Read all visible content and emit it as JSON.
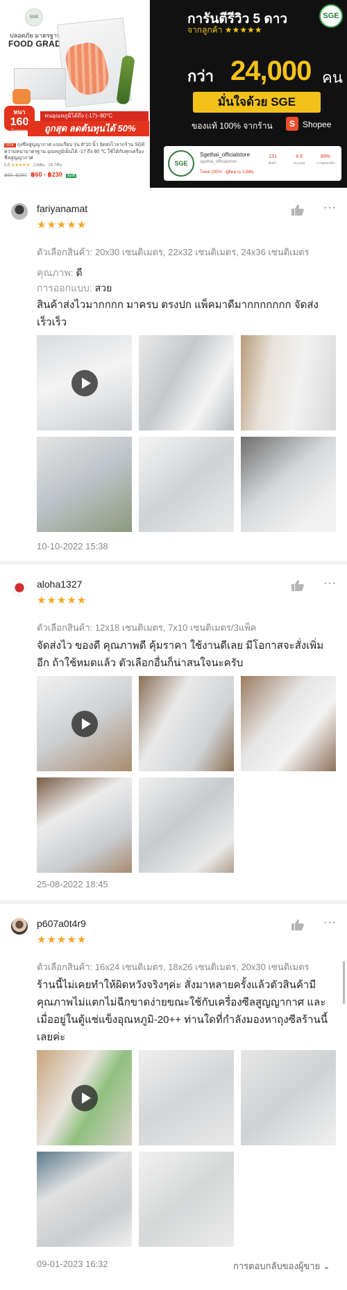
{
  "banner_left": {
    "logo_text": "SGE",
    "tagline": "ปลอดภัย มาตรฐาน",
    "food_grade": "FOOD GRADE",
    "thickness_badge": {
      "label": "หนา",
      "value": "160",
      "unit": "ไมครอน"
    },
    "temperature_note": "ทนอุณหภูมิได้ถึง (-17)–80°C",
    "sale_text": "ถูกสุด ลดต้นทุนได้ 50%",
    "seller_tag": "SGE",
    "product_title": "ถุงซีลสูญญากาศ แบบเรียบ รุ่น 8*10 นิ้ว จัดส่งไวจากร้าน SGE ความหนามาตรฐาน อุณหภูมิเย็นได้ -17 ถึง 80 ℃ ใช้ได้กับทุกเครื่องซีลสูญญากาศ",
    "rating_value": "5.0",
    "stars": "★★★★★",
    "rating_count": "2.6พัน",
    "sold_count": "24.7พัน",
    "original_price": "฿86–฿290",
    "price": "฿60 - ฿230",
    "chip": "ส่งฟรี"
  },
  "banner_right": {
    "logo_text": "SGE",
    "guarantee": "การันตีรีวิว 5 ดาว",
    "from_customers": "จากลูกค้า ★★★★★",
    "more_than": "กว่า",
    "number": "24,000",
    "people": "คน",
    "trust": "มั่นใจด้วย SGE",
    "original": "ของแท้ 100% จากร้าน",
    "shopee_icon": "S",
    "shopee": "Shopee",
    "card": {
      "logo_text": "SGE",
      "store_name": "Sgethai_officialstore",
      "sub": "sgethai_officialstore",
      "meta": "โหลด 100% · ผู้ติดตาม 3.8พัน",
      "stats": [
        {
          "value": "131",
          "label": "สินค้า"
        },
        {
          "value": "4.9",
          "label": "คะแนน"
        },
        {
          "value": "89%",
          "label": "การตอบกลับ"
        }
      ]
    }
  },
  "reviews": [
    {
      "username": "fariyanamat",
      "stars": "★★★★★",
      "variation": "ตัวเลือกสินค้า: 20x30 เซนติเมตร, 22x32 เซนติเมตร, 24x36 เซนติเมตร",
      "quality_label": "คุณภาพ:",
      "quality_value": "ดี",
      "design_label": "การออกแบบ:",
      "design_value": "สวย",
      "text": "สินค้าส่งไวมากกกก มาครบ ตรงปก แพ็คมาดีมากกกกกกก จัดส่งเร็วเร็ว",
      "date": "10-10-2022 15:38",
      "more": "···"
    },
    {
      "username": "aloha1327",
      "stars": "★★★★★",
      "variation": "ตัวเลือกสินค้า: 12x18 เซนติเมตร, 7x10 เซนติเมตร/3แพ็ค",
      "text": "จัดส่งไว ของดี คุณภาพดี คุ้มราคา ใช้งานดีเลย มีโอกาสจะสั่งเพิ่มอีก ถ้าใช้หมดแล้ว ตัวเลือกอื่นก็น่าสนใจนะครับ",
      "date": "25-08-2022 18:45",
      "more": "···"
    },
    {
      "username": "p607a0t4r9",
      "stars": "★★★★★",
      "variation": "ตัวเลือกสินค้า: 16x24 เซนติเมตร, 18x26 เซนติเมตร, 20x30 เซนติเมตร",
      "text": "ร้านนี้ไม่เคยทำให้ผิดหวังจริงๆค่ะ สั่งมาหลายครั้งแล้วตัวสินค้ามีคุณภาพไม่แตกไม่ฉีกขาดง่ายขณะใช้กับเครื่องซีลสูญญากาศ และเมื่ออยู่ในตู้แช่แข็งอุณหภูมิ-20++ ท่านใดที่กำลังมองหาถุงซีลร้านนี้เลยค่ะ",
      "date": "09-01-2023 16:32",
      "reply": "การตอบกลับของผู้ขาย",
      "more": "···"
    }
  ]
}
